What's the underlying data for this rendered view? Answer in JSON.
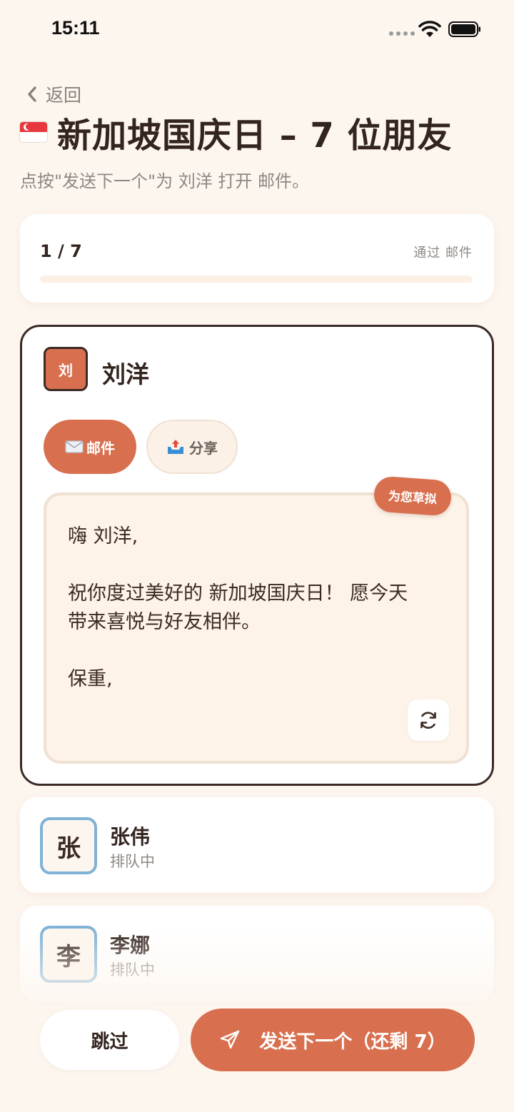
{
  "status_bar": {
    "time": "15:11"
  },
  "header": {
    "back_label": "返回",
    "title": "新加坡国庆日 – 7 位朋友",
    "subtitle": "点按\"发送下一个\"为 刘洋 打开 邮件。"
  },
  "progress": {
    "count": "1 / 7",
    "via": "通过 邮件",
    "fraction": 0.0
  },
  "active_contact": {
    "initial": "刘",
    "name": "刘洋",
    "mail_button": "邮件",
    "share_button": "分享",
    "draft_badge": "为您草拟",
    "draft_greeting": "嗨 刘洋,",
    "draft_body_line1": "祝你度过美好的 新加坡国庆日！ 愿今天",
    "draft_body_line2": "带来喜悦与好友相伴。",
    "draft_signoff": "保重,"
  },
  "queue": [
    {
      "initial": "张",
      "name": "张伟",
      "status": "排队中"
    },
    {
      "initial": "李",
      "name": "李娜",
      "status": "排队中"
    }
  ],
  "footer": {
    "skip_label": "跳过",
    "send_label": "发送下一个（还剩 7）"
  },
  "colors": {
    "accent": "#d8704f",
    "background": "#fdf6ef",
    "queue_avatar_border": "#7fb2d6"
  }
}
